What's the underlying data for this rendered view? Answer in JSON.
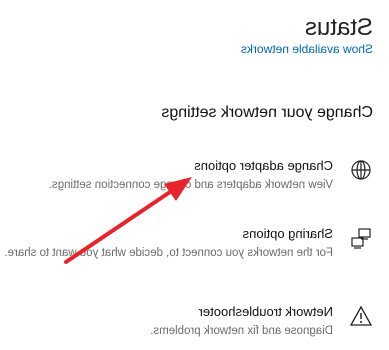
{
  "header": {
    "title": "Status",
    "link": "Show available networks"
  },
  "section": {
    "heading": "Change your network settings"
  },
  "items": [
    {
      "title": "Change adapter options",
      "description": "View network adapters and change connection settings.",
      "icon": "globe-network-icon"
    },
    {
      "title": "Sharing options",
      "description": "For the networks you connect to, decide what you want to share.",
      "icon": "sharing-computers-icon"
    },
    {
      "title": "Network troubleshooter",
      "description": "Diagnose and fix network problems.",
      "icon": "warning-triangle-icon"
    }
  ],
  "annotation": {
    "arrow_color": "#e8232a",
    "points_to": "Change adapter options"
  },
  "colors": {
    "link": "#0067b8",
    "text": "#111111",
    "secondary_text": "#6b6b6b"
  }
}
